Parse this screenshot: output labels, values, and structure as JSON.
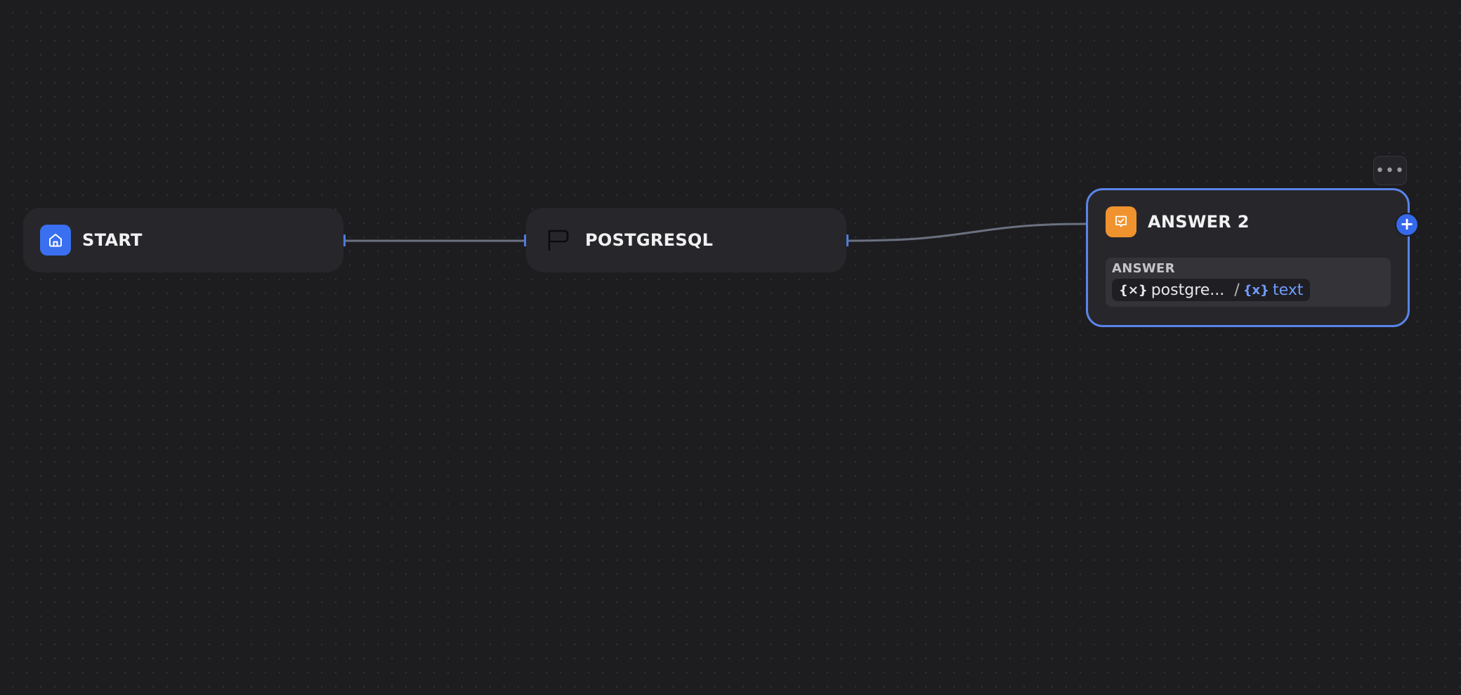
{
  "canvas": {
    "background": "#1d1d20",
    "dot_color": "#2e2e34"
  },
  "nodes": {
    "start": {
      "title": "START",
      "icon": "home-icon",
      "icon_color": "#3a6ff0"
    },
    "postgres": {
      "title": "POSTGRESQL",
      "icon": "postgresql-icon"
    },
    "answer": {
      "title": "ANSWER 2",
      "icon": "answer-icon",
      "icon_color": "#f0932f",
      "selected": true,
      "border_color": "#5b84e8",
      "field_label": "ANSWER",
      "variable": {
        "source_icon": "variable-icon",
        "source": "postgre...",
        "separator": "/",
        "name_icon": "variable-icon",
        "name": "text"
      }
    }
  },
  "edges": [
    {
      "from": "START",
      "to": "POSTGRESQL"
    },
    {
      "from": "POSTGRESQL",
      "to": "ANSWER 2"
    }
  ],
  "controls": {
    "more_label": "•••",
    "add_label": "+",
    "accent": "#3568ea"
  }
}
